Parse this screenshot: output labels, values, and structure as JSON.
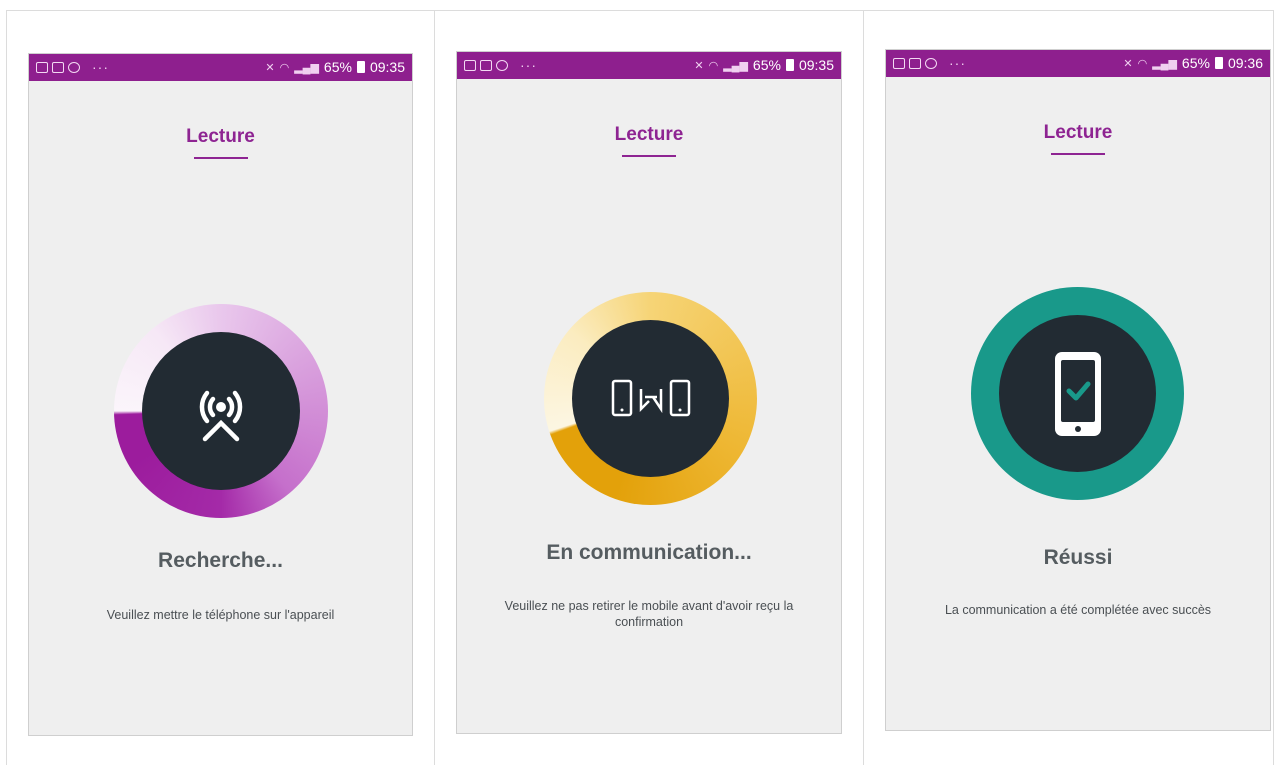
{
  "screens": [
    {
      "status_bar": {
        "battery": "65%",
        "time": "09:35"
      },
      "header_title": "Lecture",
      "status_title": "Recherche...",
      "status_message": "Veuillez mettre le téléphone sur l'appareil",
      "icon": "nfc-reader-icon",
      "ring_color": "#9c1c9d",
      "progress": 0.25
    },
    {
      "status_bar": {
        "battery": "65%",
        "time": "09:35"
      },
      "header_title": "Lecture",
      "status_title": "En communication...",
      "status_message": "Veuillez ne pas retirer le mobile avant d'avoir reçu la confirmation",
      "icon": "phone-transfer-icon",
      "ring_color": "#e3a10a",
      "progress": 0.7
    },
    {
      "status_bar": {
        "battery": "65%",
        "time": "09:36"
      },
      "header_title": "Lecture",
      "status_title": "Réussi",
      "status_message": "La communication a été complétée avec succès",
      "icon": "phone-check-icon",
      "ring_color": "#19998a",
      "progress": 1
    }
  ],
  "colors": {
    "status_bar": "#8e1f8e",
    "accent": "#8e2492",
    "icon_background": "#222b33",
    "screen_background": "#efefef"
  }
}
